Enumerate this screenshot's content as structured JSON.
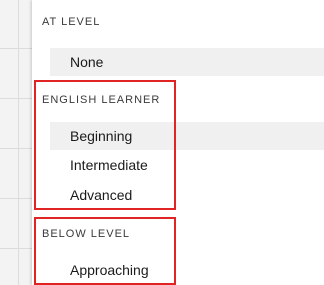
{
  "dropdown": {
    "groups": [
      {
        "header": "AT LEVEL",
        "options": [
          {
            "label": "None",
            "highlighted": true
          }
        ]
      },
      {
        "header": "ENGLISH LEARNER",
        "options": [
          {
            "label": "Beginning",
            "highlighted": true
          },
          {
            "label": "Intermediate",
            "highlighted": false
          },
          {
            "label": "Advanced",
            "highlighted": false
          }
        ]
      },
      {
        "header": "BELOW LEVEL",
        "options": [
          {
            "label": "Approaching",
            "highlighted": false
          }
        ]
      }
    ]
  },
  "colors": {
    "highlight_box": "#e02424",
    "option_hover": "#f0f0f0"
  }
}
